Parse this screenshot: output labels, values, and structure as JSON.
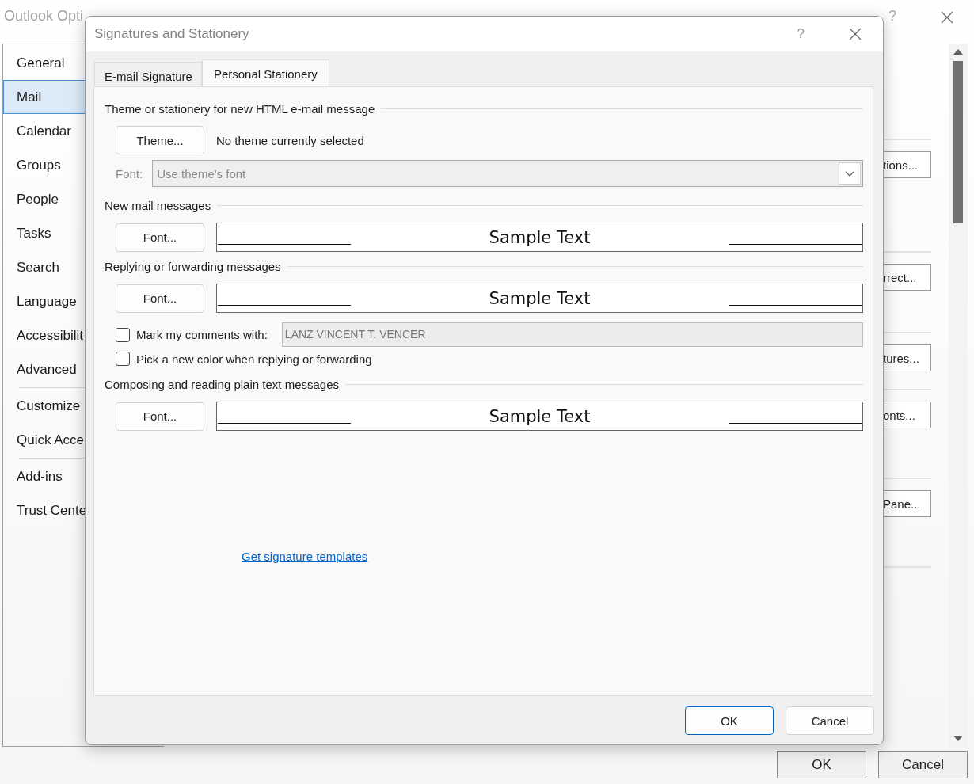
{
  "background_window": {
    "title": "Outlook Opti",
    "help": "?",
    "sidebar": {
      "groups": [
        {
          "items": [
            {
              "label": "General",
              "selected": false
            },
            {
              "label": "Mail",
              "selected": true
            },
            {
              "label": "Calendar",
              "selected": false
            },
            {
              "label": "Groups",
              "selected": false
            },
            {
              "label": "People",
              "selected": false
            },
            {
              "label": "Tasks",
              "selected": false
            },
            {
              "label": "Search",
              "selected": false
            },
            {
              "label": "Language",
              "selected": false
            },
            {
              "label": "Accessibilit",
              "selected": false
            },
            {
              "label": "Advanced",
              "selected": false
            }
          ]
        },
        {
          "items": [
            {
              "label": "Customize",
              "selected": false
            },
            {
              "label": "Quick Acce",
              "selected": false
            }
          ]
        },
        {
          "items": [
            {
              "label": "Add-ins",
              "selected": false
            },
            {
              "label": "Trust Cente",
              "selected": false
            }
          ]
        }
      ]
    },
    "option_buttons": [
      "tions...",
      "rrect...",
      "tures...",
      "onts...",
      "Pane..."
    ],
    "buttons": [
      "OK",
      "Cancel"
    ]
  },
  "dialog": {
    "title": "Signatures and Stationery",
    "help": "?",
    "tabs": [
      {
        "label": "E-mail Signature",
        "selected": false
      },
      {
        "label": "Personal Stationery",
        "selected": true
      }
    ],
    "sections": [
      {
        "heading": "Theme or stationery for new HTML e-mail message",
        "rows": [
          {
            "kind": "theme",
            "button": "Theme...",
            "text": "No theme currently selected"
          },
          {
            "kind": "select",
            "label": "Font:",
            "value": "Use theme's font",
            "disabled": true
          }
        ]
      },
      {
        "heading": "New mail messages",
        "rows": [
          {
            "kind": "font",
            "button": "Font...",
            "sample": "Sample Text"
          }
        ]
      },
      {
        "heading": "Replying or forwarding messages",
        "rows": [
          {
            "kind": "font",
            "button": "Font...",
            "sample": "Sample Text"
          },
          {
            "kind": "check_field",
            "label": "Mark my comments with:",
            "checked": false,
            "value": "LANZ VINCENT T. VENCER"
          },
          {
            "kind": "check",
            "label": "Pick a new color when replying or forwarding",
            "checked": false
          }
        ]
      },
      {
        "heading": "Composing and reading plain text messages",
        "rows": [
          {
            "kind": "font",
            "button": "Font...",
            "sample": "Sample Text"
          }
        ]
      }
    ],
    "link": "Get signature templates",
    "buttons": [
      {
        "label": "OK",
        "default": true
      },
      {
        "label": "Cancel",
        "default": false
      }
    ]
  }
}
